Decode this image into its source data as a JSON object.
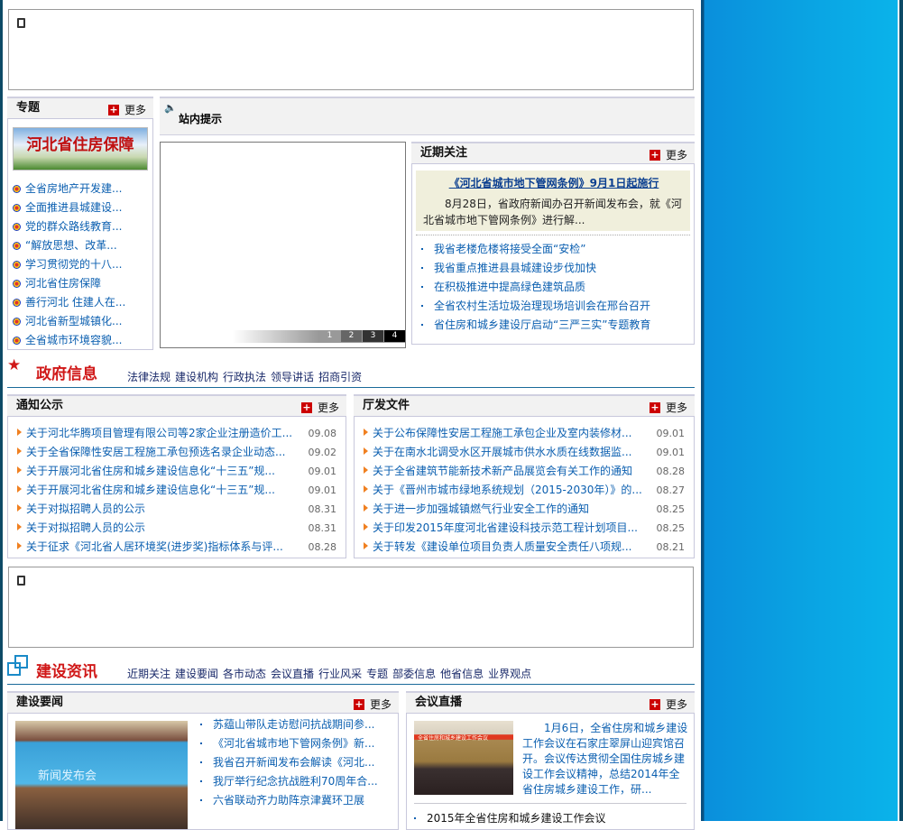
{
  "colors": {
    "link": "#0b5fb0",
    "accent": "#d01818",
    "panel_blue": "#0aa2e2"
  },
  "more_label": "更多",
  "zhuanti": {
    "title": "专题",
    "banner_text": "河北省住房保障",
    "items": [
      "全省房地产开发建...",
      "全面推进县城建设...",
      "党的群众路线教育...",
      "“解放思想、改革...",
      "学习贯彻党的十八...",
      "河北省住房保障",
      "善行河北 住建人在...",
      "河北省新型城镇化...",
      "全省城市环境容貌..."
    ]
  },
  "notice": {
    "title": "站内提示"
  },
  "slider": {
    "pages": [
      "1",
      "2",
      "3",
      "4"
    ]
  },
  "jinqi": {
    "title": "近期关注",
    "headline": "《河北省城市地下管网条例》9月1日起施行",
    "summary": "8月28日，省政府新闻办召开新闻发布会，就《河北省城市地下管网条例》进行解...",
    "items": [
      "我省老楼危楼将接受全面“安检”",
      "我省重点推进县县城建设步伐加快",
      "在积极推进中提高绿色建筑品质",
      "全省农村生活垃圾治理现场培训会在邢台召开",
      "省住房和城乡建设厅启动“三严三实”专题教育"
    ]
  },
  "gov": {
    "title": "政府信息",
    "nav": [
      "法律法规",
      "建设机构",
      "行政执法",
      "领导讲话",
      "招商引资"
    ]
  },
  "tongzhi": {
    "title": "通知公示",
    "items": [
      {
        "text": "关于河北华腾项目管理有限公司等2家企业注册造价工...",
        "date": "09.08"
      },
      {
        "text": "关于全省保障性安居工程施工承包预选名录企业动态...",
        "date": "09.02"
      },
      {
        "text": "关于开展河北省住房和城乡建设信息化“十三五”规...",
        "date": "09.01"
      },
      {
        "text": "关于开展河北省住房和城乡建设信息化“十三五”规...",
        "date": "09.01"
      },
      {
        "text": "关于对拟招聘人员的公示",
        "date": "08.31"
      },
      {
        "text": "关于对拟招聘人员的公示",
        "date": "08.31"
      },
      {
        "text": "关于征求《河北省人居环境奖(进步奖)指标体系与评...",
        "date": "08.28"
      }
    ]
  },
  "tingfa": {
    "title": "厅发文件",
    "items": [
      {
        "text": "关于公布保障性安居工程施工承包企业及室内装修材...",
        "date": "09.01"
      },
      {
        "text": "关于在南水北调受水区开展城市供水水质在线数据监...",
        "date": "09.01"
      },
      {
        "text": "关于全省建筑节能新技术新产品展览会有关工作的通知",
        "date": "08.28"
      },
      {
        "text": "关于《晋州市城市绿地系统规划（2015-2030年）》的...",
        "date": "08.27"
      },
      {
        "text": "关于进一步加强城镇燃气行业安全工作的通知",
        "date": "08.25"
      },
      {
        "text": "关于印发2015年度河北省建设科技示范工程计划项目...",
        "date": "08.25"
      },
      {
        "text": "关于转发《建设单位项目负责人质量安全责任八项规...",
        "date": "08.21"
      }
    ]
  },
  "jianshe": {
    "title": "建设资讯",
    "nav": [
      "近期关注",
      "建设要闻",
      "各市动态",
      "会议直播",
      "行业风采",
      "专题",
      "部委信息",
      "他省信息",
      "业界观点"
    ]
  },
  "yaowen": {
    "title": "建设要闻",
    "photo_text": "新闻发布会",
    "items": [
      "苏蕴山带队走访慰问抗战期间参...",
      "《河北省城市地下管网条例》新...",
      "我省召开新闻发布会解读《河北...",
      "我厅举行纪念抗战胜利70周年合...",
      "六省联动齐力助阵京津冀环卫展"
    ]
  },
  "huiyi": {
    "title": "会议直播",
    "photo_text": "全省住房和城乡建设工作会议",
    "summary": "1月6日，全省住房和城乡建设工作会议在石家庄翠屏山迎宾馆召开。会议传达贯彻全国住房城乡建设工作会议精神，总结2014年全省住房城乡建设工作，研...",
    "items": [
      "2015年全省住房和城乡建设工作会议"
    ]
  }
}
